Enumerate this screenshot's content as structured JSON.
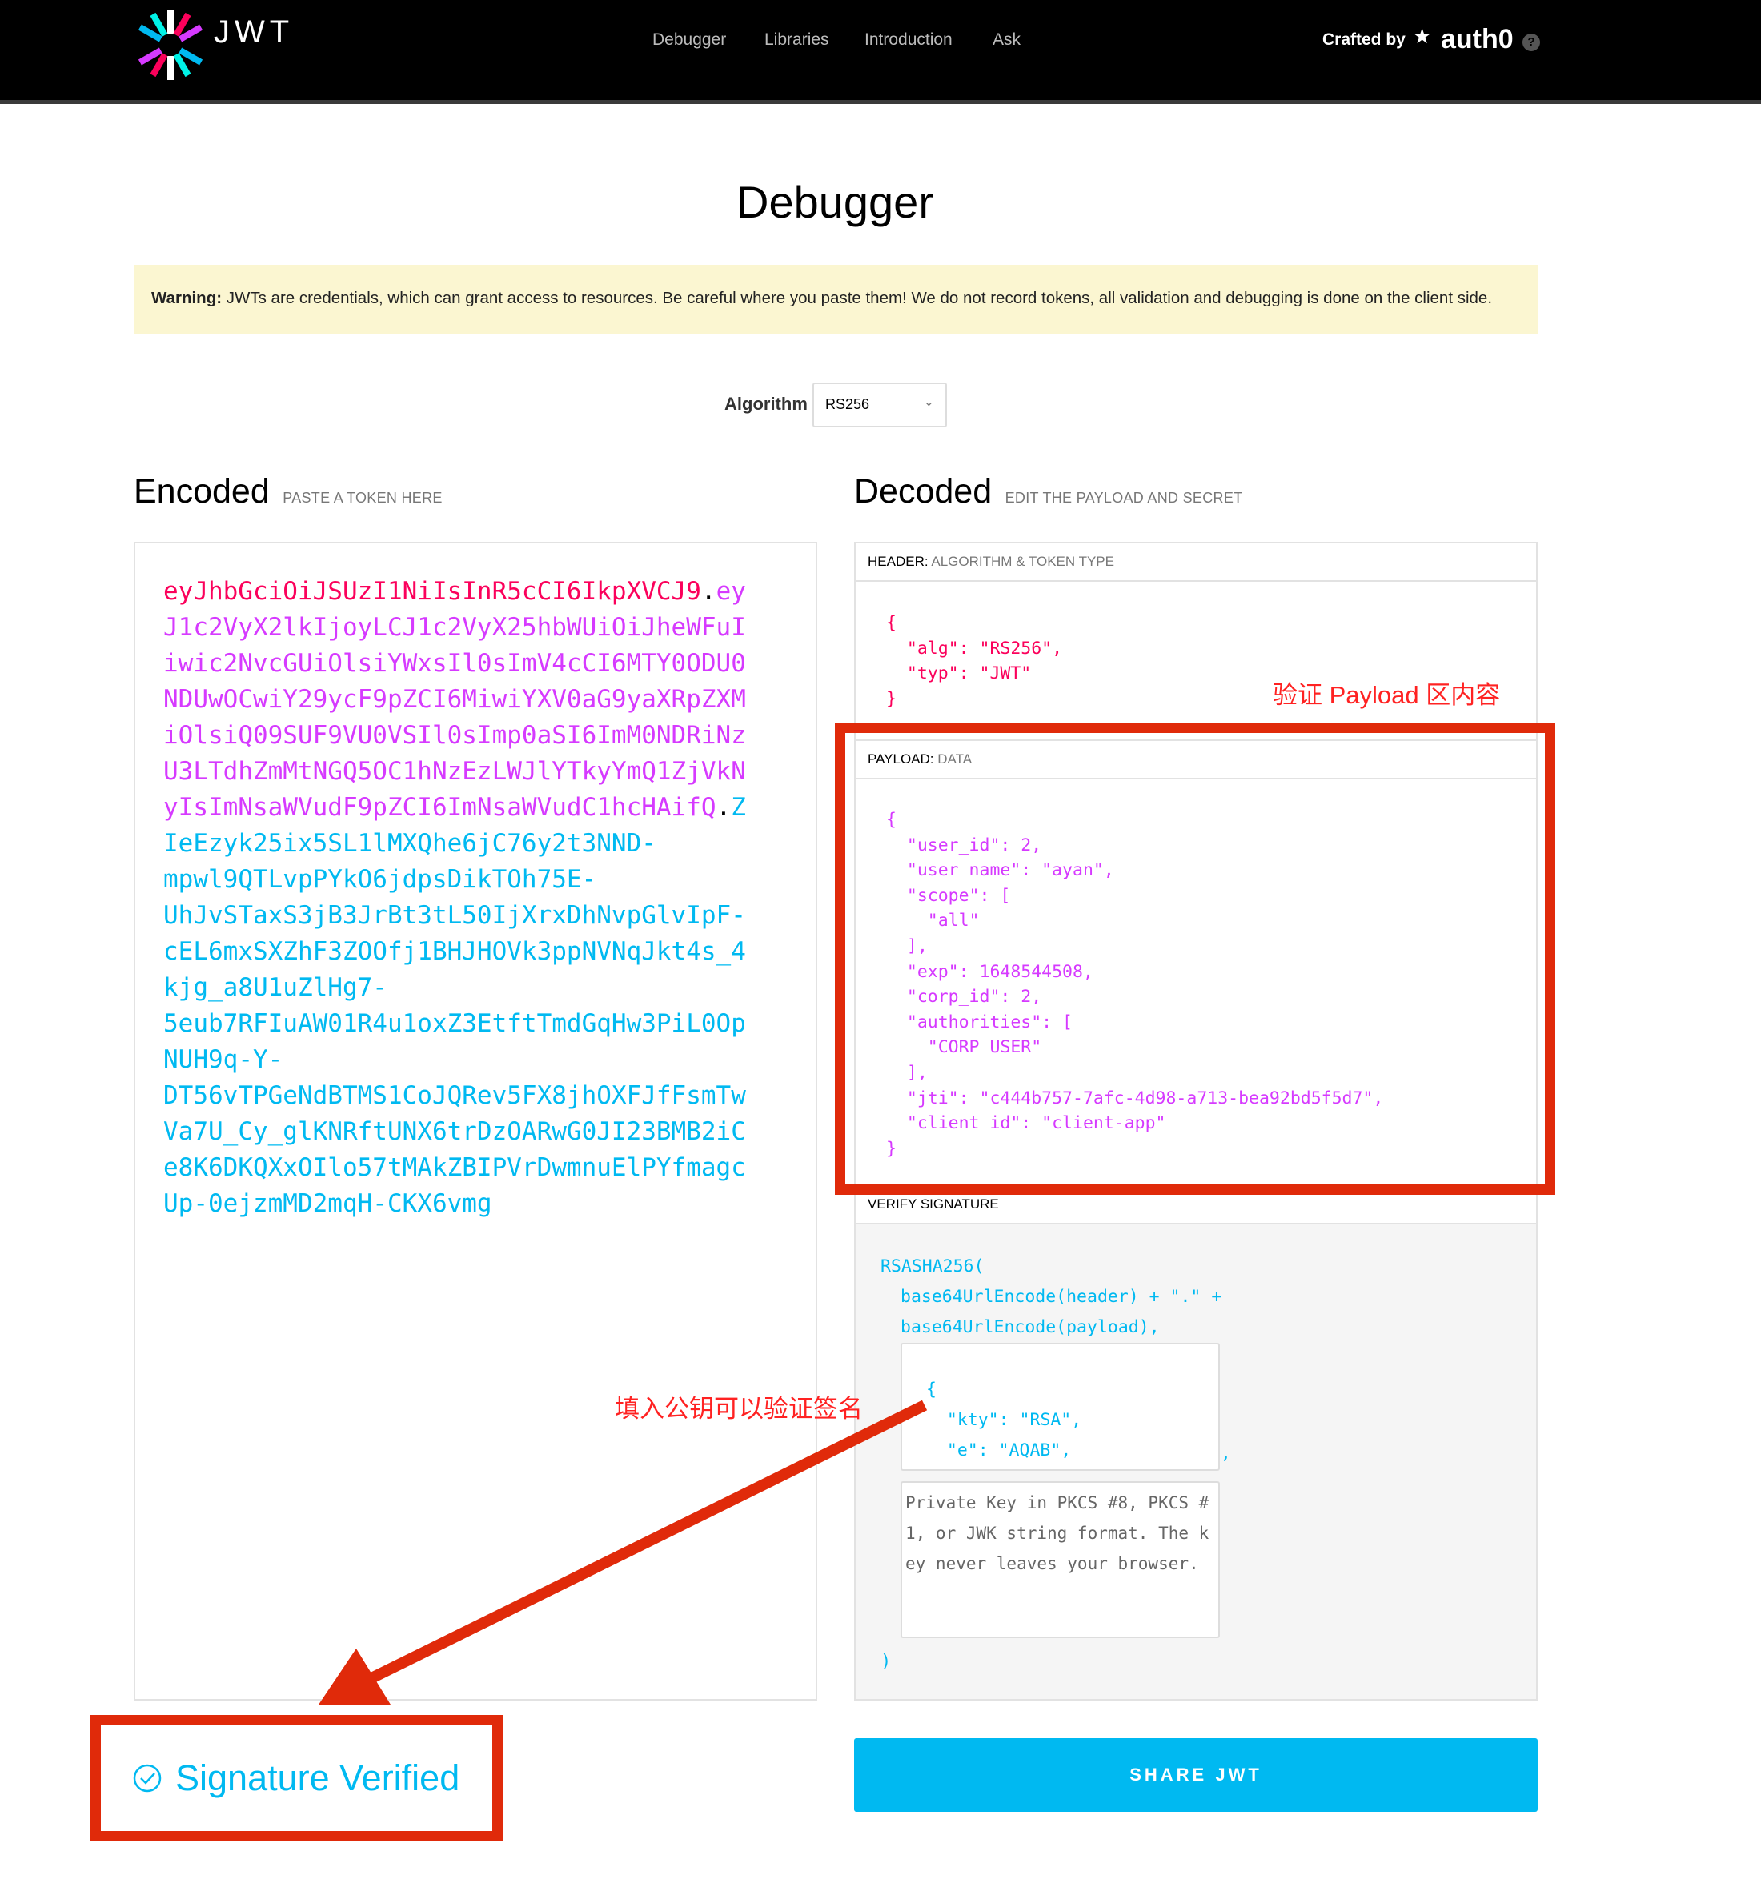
{
  "nav": {
    "logo_text": "JWT",
    "links": [
      "Debugger",
      "Libraries",
      "Introduction",
      "Ask"
    ],
    "crafted_by": "Crafted by",
    "brand": "auth0",
    "help": "?"
  },
  "page_title": "Debugger",
  "warning": {
    "label": "Warning:",
    "text": " JWTs are credentials, which can grant access to resources. Be careful where you paste them! We do not record tokens, all validation and debugging is done on the client side."
  },
  "algorithm": {
    "label": "Algorithm",
    "value": "RS256"
  },
  "encoded": {
    "title": "Encoded",
    "subtitle": "PASTE A TOKEN HERE",
    "header_part": "eyJhbGciOiJSUzI1NiIsInR5cCI6IkpXVCJ9",
    "payload_part": "eyJ1c2VyX2lkIjoyLCJ1c2VyX25hbWUiOiJheWFuIiwic2NvcGUiOlsiYWxsIl0sImV4cCI6MTY0ODU0NDUwOCwiY29ycF9pZCI6MiwiYXV0aG9yaXRpZXMiOlsiQ09SUF9VU0VSIl0sImp0aSI6ImM0NDRiNzU3LTdhZmMtNGQ5OC1hNzEzLWJlYTkyYmQ1ZjVkNyIsImNsaWVudF9pZCI6ImNsaWVudC1hcHAifQ",
    "signature_part": "ZIeEzyk25ix5SL1lMXQhe6jC76y2t3NND-mpwl9QTLvpPYkO6jdpsDikTOh75E-UhJvSTaxS3jB3JrBt3tL50IjXrxDhNvpGlvIpF-cEL6mxSXZhF3ZOOfj1BHJHOVk3ppNVNqJkt4s_4kjg_a8U1uZlHg7-5eub7RFIuAW01R4u1oxZ3EtftTmdGqHw3PiL0Op NUH9q-Y-DT56vTPGeNdBTMS1CoJQRev5FX8jhOXFJfFsmTwVa7U_Cy_glKNRftUNX6trDzOARwG0JI23BMB2iCe8K6DKQXxOIlo57tMAkZBIPVrDwmnuElPYfmagcUp-0ejzmMD2mqH-CKX6vmg",
    "lines": [
      [
        [
          "red",
          "eyJhbGciOiJSUzI1NiIsInR5cCI6IkpXVCJ9"
        ],
        [
          "dot",
          "."
        ],
        [
          "pur",
          "ey"
        ]
      ],
      [
        [
          "pur",
          "J1c2VyX2lkIjoyLCJ1c2VyX25hbWUiOiJheWFuI"
        ]
      ],
      [
        [
          "pur",
          "iwic2NvcGUiOlsiYWxsIl0sImV4cCI6MTY0ODU0"
        ]
      ],
      [
        [
          "pur",
          "NDUwOCwiY29ycF9pZCI6MiwiYXV0aG9yaXRpZXM"
        ]
      ],
      [
        [
          "pur",
          "iOlsiQ09SUF9VU0VSIl0sImp0aSI6ImM0NDRiNz"
        ]
      ],
      [
        [
          "pur",
          "U3LTdhZmMtNGQ5OC1hNzEzLWJlYTkyYmQ1ZjVkN"
        ]
      ],
      [
        [
          "pur",
          "yIsImNsaWVudF9pZCI6ImNsaWVudC1hcHAifQ"
        ],
        [
          "dot",
          "."
        ],
        [
          "cy",
          "Z"
        ]
      ],
      [
        [
          "cy",
          "IeEzyk25ix5SL1lMXQhe6jC76y2t3NND-"
        ]
      ],
      [
        [
          "cy",
          "mpwl9QTLvpPYkO6jdpsDikTOh75E-"
        ]
      ],
      [
        [
          "cy",
          "UhJvSTaxS3jB3JrBt3tL50IjXrxDhNvpGlvIpF-"
        ]
      ],
      [
        [
          "cy",
          "cEL6mxSXZhF3ZOOfj1BHJHOVk3ppNVNqJkt4s_4"
        ]
      ],
      [
        [
          "cy",
          "kjg_a8U1uZlHg7-"
        ]
      ],
      [
        [
          "cy",
          "5eub7RFIuAW01R4u1oxZ3EtftTmdGqHw3PiL0Op"
        ]
      ],
      [
        [
          "cy",
          "NUH9q-Y-"
        ]
      ],
      [
        [
          "cy",
          "DT56vTPGeNdBTMS1CoJQRev5FX8jhOXFJfFsmTw"
        ]
      ],
      [
        [
          "cy",
          "Va7U_Cy_glKNRftUNX6trDzOARwG0JI23BMB2iC"
        ]
      ],
      [
        [
          "cy",
          "e8K6DKQXxOIlo57tMAkZBIPVrDwmnuElPYfmagc"
        ]
      ],
      [
        [
          "cy",
          "Up-0ejzmMD2mqH-CKX6vmg"
        ]
      ]
    ]
  },
  "decoded": {
    "title": "Decoded",
    "subtitle": "EDIT THE PAYLOAD AND SECRET",
    "header": {
      "label": "HEADER:",
      "sublabel": "ALGORITHM & TOKEN TYPE",
      "json": "{\n  \"alg\": \"RS256\",\n  \"typ\": \"JWT\"\n}"
    },
    "payload": {
      "label": "PAYLOAD:",
      "sublabel": "DATA",
      "json": "{\n  \"user_id\": 2,\n  \"user_name\": \"ayan\",\n  \"scope\": [\n    \"all\"\n  ],\n  \"exp\": 1648544508,\n  \"corp_id\": 2,\n  \"authorities\": [\n    \"CORP_USER\"\n  ],\n  \"jti\": \"c444b757-7afc-4d98-a713-bea92bd5f5d7\",\n  \"client_id\": \"client-app\"\n}"
    },
    "verify": {
      "label": "VERIFY SIGNATURE",
      "fn_open": "RSASHA256(",
      "line1": "base64UrlEncode(header) + \".\" +",
      "line2": "base64UrlEncode(payload),",
      "public_key": "\n{\n  \"kty\": \"RSA\",\n  \"e\": \"AQAB\",",
      "comma": ",",
      "private_key_placeholder": "Private Key in PKCS #8, PKCS #1, or JWK string format. The key never leaves your browser.",
      "fn_close": ")"
    }
  },
  "status": {
    "text": "Signature Verified",
    "icon": "check-circle-icon"
  },
  "share_button": "SHARE JWT",
  "annotations": {
    "payload_note": "验证 Payload 区内容",
    "key_note": "填入公钥可以验证签名"
  },
  "colors": {
    "header": "#fb015b",
    "payload": "#d63aff",
    "signature": "#00b9f1",
    "annotation": "#e02a0a",
    "warning_bg": "#fbf6d1"
  }
}
